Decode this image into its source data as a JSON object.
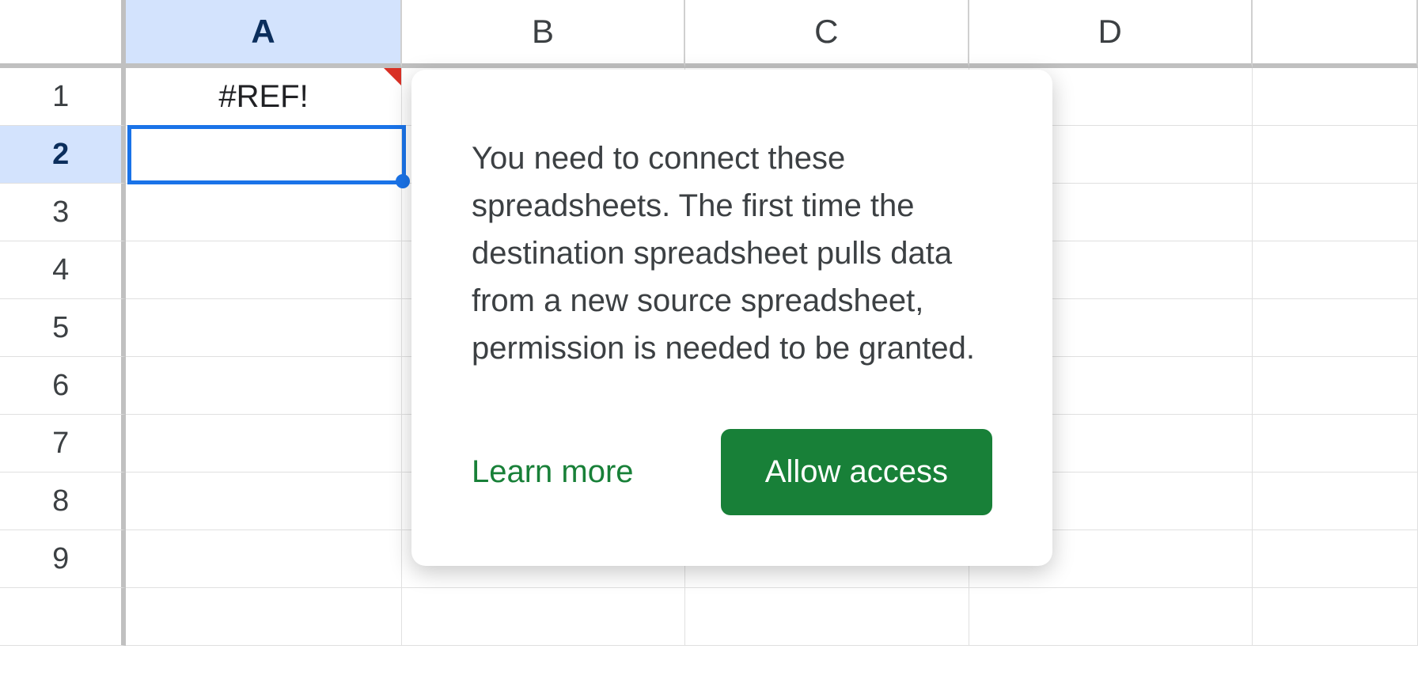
{
  "columns": [
    "A",
    "B",
    "C",
    "D"
  ],
  "rows": [
    "1",
    "2",
    "3",
    "4",
    "5",
    "6",
    "7",
    "8",
    "9"
  ],
  "active_column_index": 0,
  "active_row_index": 1,
  "cells": {
    "A1": "#REF!"
  },
  "popup": {
    "message": "You need to connect these spreadsheets. The first time the destination spreadsheet pulls data from a new source spreadsheet, permission is needed to be granted.",
    "learn_more_label": "Learn more",
    "allow_access_label": "Allow access"
  }
}
